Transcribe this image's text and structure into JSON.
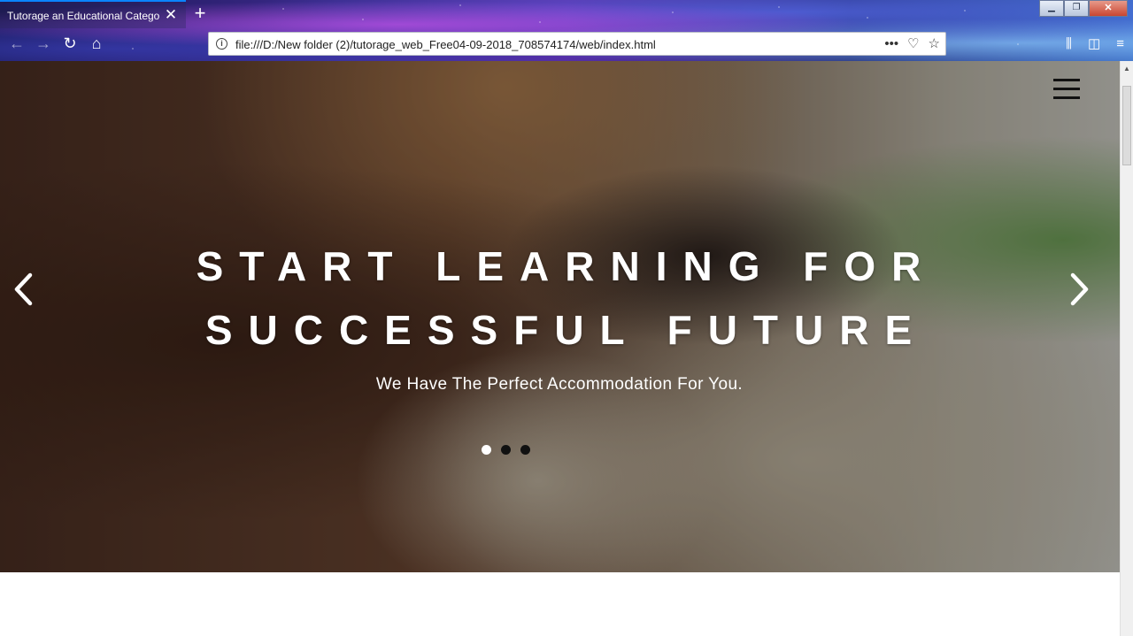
{
  "browser": {
    "tab_title": "Tutorage an Educational Category",
    "tab_close": "✕",
    "new_tab": "+",
    "url": "file:///D:/New folder (2)/tutorage_web_Free04-09-2018_708574174/web/index.html",
    "window_controls": {
      "minimize": "▁",
      "maximize": "❐",
      "close": "✕"
    },
    "nav": {
      "back": "←",
      "forward": "→",
      "reload": "↻",
      "home": "⌂"
    },
    "url_actions": {
      "more": "•••",
      "pocket": "♡",
      "bookmark": "☆"
    },
    "toolbar_right": {
      "library": "⫼",
      "sidebar": "◫",
      "menu": "≡"
    }
  },
  "hero": {
    "title_line1": "START LEARNING FOR",
    "title_line2": "SUCCESSFUL FUTURE",
    "subtitle": "We Have The Perfect Accommodation For You.",
    "slides_count": 3,
    "active_slide": 1
  },
  "colors": {
    "tab_accent": "#0a84ff",
    "hero_text": "#ffffff",
    "dot_inactive": "#111111",
    "dot_active": "#ffffff"
  },
  "icons": {
    "menu": "hamburger-menu-icon",
    "prev": "chevron-left-icon",
    "next": "chevron-right-icon"
  }
}
